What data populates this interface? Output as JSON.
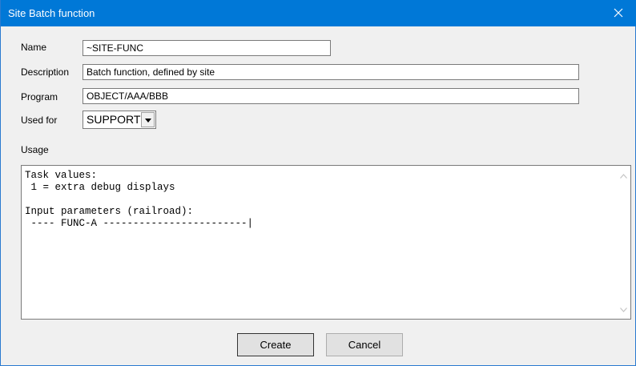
{
  "window": {
    "title": "Site Batch function"
  },
  "form": {
    "name_label": "Name",
    "name_value": "~SITE-FUNC",
    "description_label": "Description",
    "description_value": "Batch function, defined by site",
    "program_label": "Program",
    "program_value": "OBJECT/AAA/BBB",
    "used_for_label": "Used for",
    "used_for_value": "SUPPORT",
    "usage_label": "Usage",
    "usage_text": "Task values:\n 1 = extra debug displays\n\nInput parameters (railroad):\n ---- FUNC-A ------------------------|"
  },
  "buttons": {
    "create": "Create",
    "cancel": "Cancel"
  },
  "colors": {
    "titlebar": "#0078d7",
    "background": "#f0f0f0"
  },
  "icons": [
    "close-icon",
    "chevron-down-icon",
    "scroll-up-icon",
    "scroll-down-icon"
  ]
}
